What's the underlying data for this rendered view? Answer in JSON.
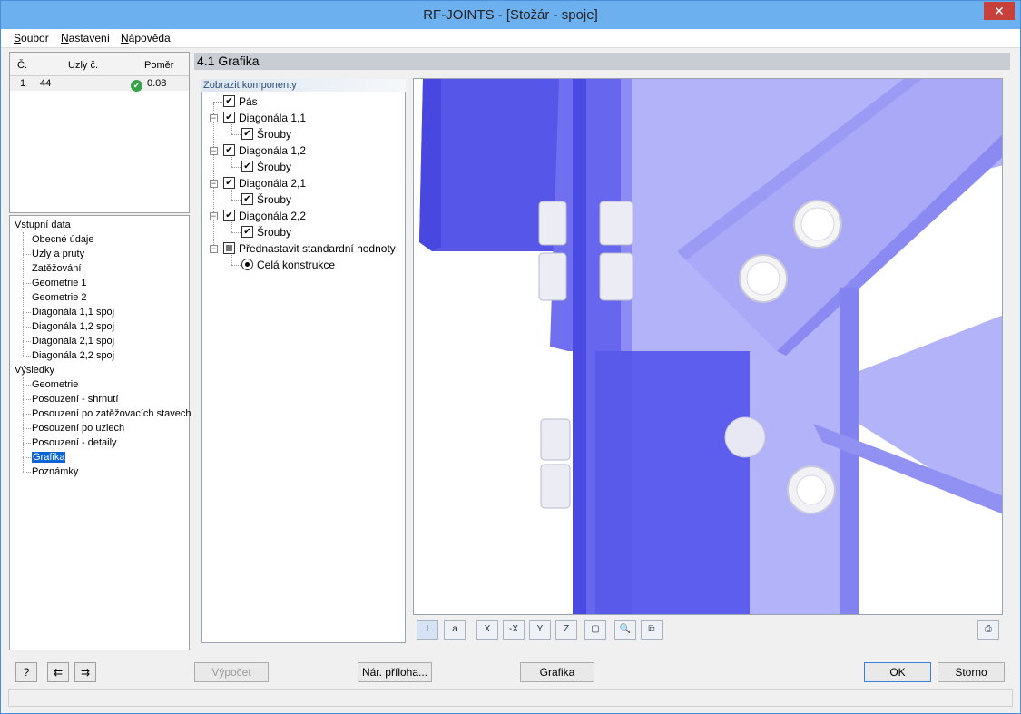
{
  "window": {
    "title": "RF-JOINTS - [Stožár - spoje]"
  },
  "menu": {
    "items": [
      {
        "key": "S",
        "rest": "oubor"
      },
      {
        "key": "N",
        "rest": "astavení"
      },
      {
        "key": "N",
        "rest": "ápověda"
      }
    ]
  },
  "joint_table": {
    "headers": {
      "no": "Č.",
      "nodes": "Uzly č.",
      "ratio": "Poměr"
    },
    "rows": [
      {
        "no": "1",
        "nodes": "44",
        "ratio": "0.08"
      }
    ]
  },
  "navigator": {
    "input_group": "Vstupní data",
    "input_items": [
      "Obecné údaje",
      "Uzly a pruty",
      "Zatěžování",
      "Geometrie 1",
      "Geometrie 2",
      "Diagonála 1,1 spoj",
      "Diagonála 1,2 spoj",
      "Diagonála 2,1 spoj",
      "Diagonála 2,2 spoj"
    ],
    "results_group": "Výsledky",
    "results_items": [
      "Geometrie",
      "Posouzení - shrnutí",
      "Posouzení po zatěžovacích stavech",
      "Posouzení po uzlech",
      "Posouzení - detaily",
      "Grafika",
      "Poznámky"
    ],
    "selected": "Grafika"
  },
  "section": {
    "title": "4.1 Grafika"
  },
  "components": {
    "header": "Zobrazit komponenty",
    "items": {
      "pas": "Pás",
      "d11": "Diagonála 1,1",
      "d11_bolts": "Šrouby",
      "d12": "Diagonála 1,2",
      "d12_bolts": "Šrouby",
      "d21": "Diagonála 2,1",
      "d21_bolts": "Šrouby",
      "d22": "Diagonála 2,2",
      "d22_bolts": "Šrouby",
      "preset": "Přednastavit standardní hodnoty",
      "whole": "Celá konstrukce"
    }
  },
  "bottom": {
    "calc": "Výpočet",
    "report": "Nár. příloha...",
    "graphics": "Grafika",
    "ok": "OK",
    "cancel": "Storno"
  },
  "colors": {
    "steel_dark": "#4b4be0",
    "steel_mid": "#6a6af0",
    "steel_light": "#a6a6f8",
    "selection": "#0a64d6"
  }
}
